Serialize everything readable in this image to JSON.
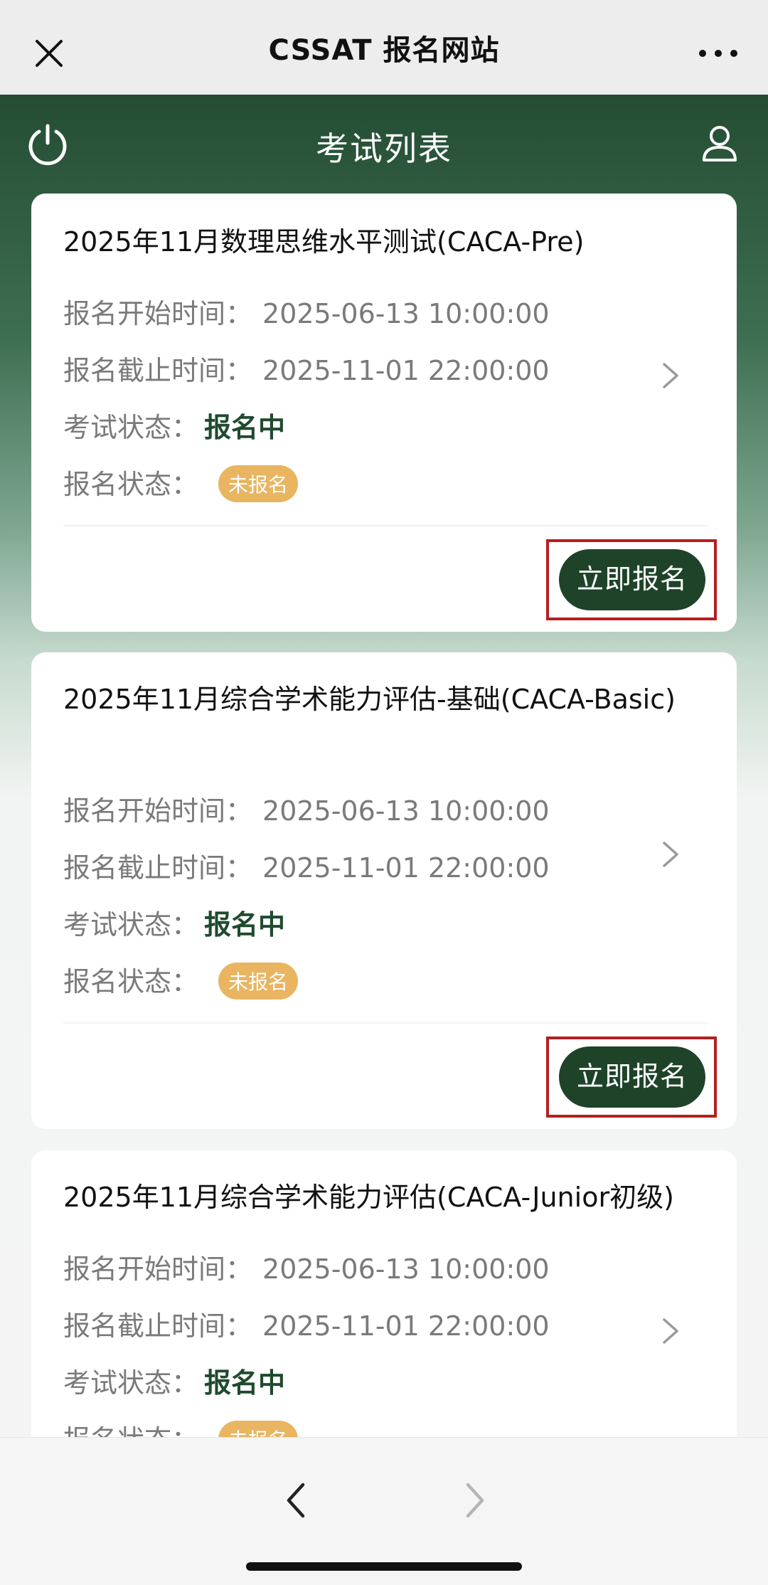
{
  "browser": {
    "title": "CSSAT 报名网站"
  },
  "header": {
    "title": "考试列表"
  },
  "labels": {
    "start": "报名开始时间：",
    "end": "报名截止时间：",
    "exam_status": "考试状态：",
    "reg_status": "报名状态："
  },
  "exams": [
    {
      "title": "2025年11月数理思维水平测试(CACA-Pre)",
      "start": "2025-06-13 10:00:00",
      "end": "2025-11-01 22:00:00",
      "exam_status": "报名中",
      "reg_status": "未报名",
      "action": "立即报名"
    },
    {
      "title": "2025年11月综合学术能力评估-基础(CACA-Basic)",
      "start": "2025-06-13 10:00:00",
      "end": "2025-11-01 22:00:00",
      "exam_status": "报名中",
      "reg_status": "未报名",
      "action": "立即报名"
    },
    {
      "title": "2025年11月综合学术能力评估(CACA-Junior初级)",
      "start": "2025-06-13 10:00:00",
      "end": "2025-11-01 22:00:00",
      "exam_status": "报名中",
      "reg_status": "未报名"
    }
  ],
  "colors": {
    "brand_green": "#1e4329",
    "badge_orange": "#e9b561",
    "highlight_red": "#b51f1f"
  }
}
